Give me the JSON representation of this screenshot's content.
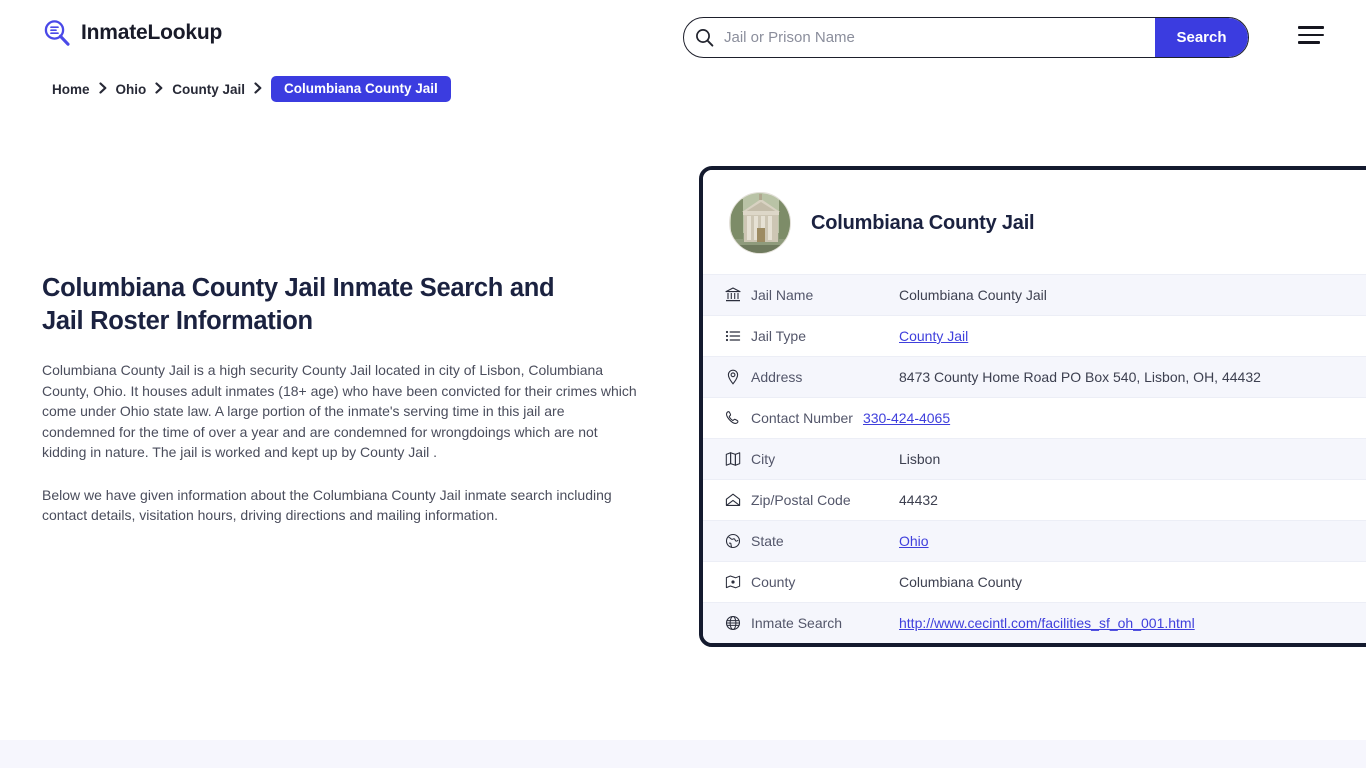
{
  "header": {
    "brand_name": "InmateLookup",
    "brand_icon": "search-list-logo-icon",
    "search": {
      "placeholder": "Jail or Prison Name",
      "value": "",
      "button_label": "Search",
      "icon": "search-icon"
    },
    "menu_icon": "hamburger-menu-icon",
    "accent_color": "#3b3ce0"
  },
  "breadcrumb": {
    "items": [
      {
        "label": "Home",
        "current": false
      },
      {
        "label": "Ohio",
        "current": false
      },
      {
        "label": "County Jail",
        "current": false
      },
      {
        "label": "Columbiana County Jail",
        "current": true
      }
    ],
    "separator_icon": "chevron-right-icon"
  },
  "main": {
    "title": "Columbiana County Jail Inmate Search and Jail Roster Information",
    "paragraphs": [
      "Columbiana County Jail is a high security County Jail located in city of Lisbon, Columbiana County, Ohio. It houses adult inmates (18+ age) who have been convicted for their crimes which come under Ohio state law. A large portion of the inmate's serving time in this jail are condemned for the time of over a year and are condemned for wrongdoings which are not kidding in nature. The jail is worked and kept up by County Jail .",
      "Below we have given information about the Columbiana County Jail inmate search including contact details, visitation hours, driving directions and mailing information."
    ]
  },
  "card": {
    "title": "Columbiana County Jail",
    "thumbnail_alt": "courthouse-photo",
    "border_color": "#141a2e",
    "rows": [
      {
        "icon": "bank-icon",
        "label": "Jail Name",
        "value": "Columbiana County Jail",
        "is_link": false
      },
      {
        "icon": "list-icon",
        "label": "Jail Type",
        "value": "County Jail",
        "is_link": true
      },
      {
        "icon": "map-pin-icon",
        "label": "Address",
        "value": "8473 County Home Road PO Box 540, Lisbon, OH, 44432",
        "is_link": false
      },
      {
        "icon": "phone-icon",
        "label": "Contact Number",
        "value": "330-424-4065",
        "is_link": true
      },
      {
        "icon": "map-icon",
        "label": "City",
        "value": "Lisbon",
        "is_link": false
      },
      {
        "icon": "envelope-icon",
        "label": "Zip/Postal Code",
        "value": "44432",
        "is_link": false
      },
      {
        "icon": "globe-state-icon",
        "label": "State",
        "value": "Ohio",
        "is_link": true
      },
      {
        "icon": "map-marked-icon",
        "label": "County",
        "value": "Columbiana County",
        "is_link": false
      },
      {
        "icon": "globe-icon",
        "label": "Inmate Search",
        "value": "http://www.cecintl.com/facilities_sf_oh_001.html",
        "is_link": true
      }
    ]
  }
}
